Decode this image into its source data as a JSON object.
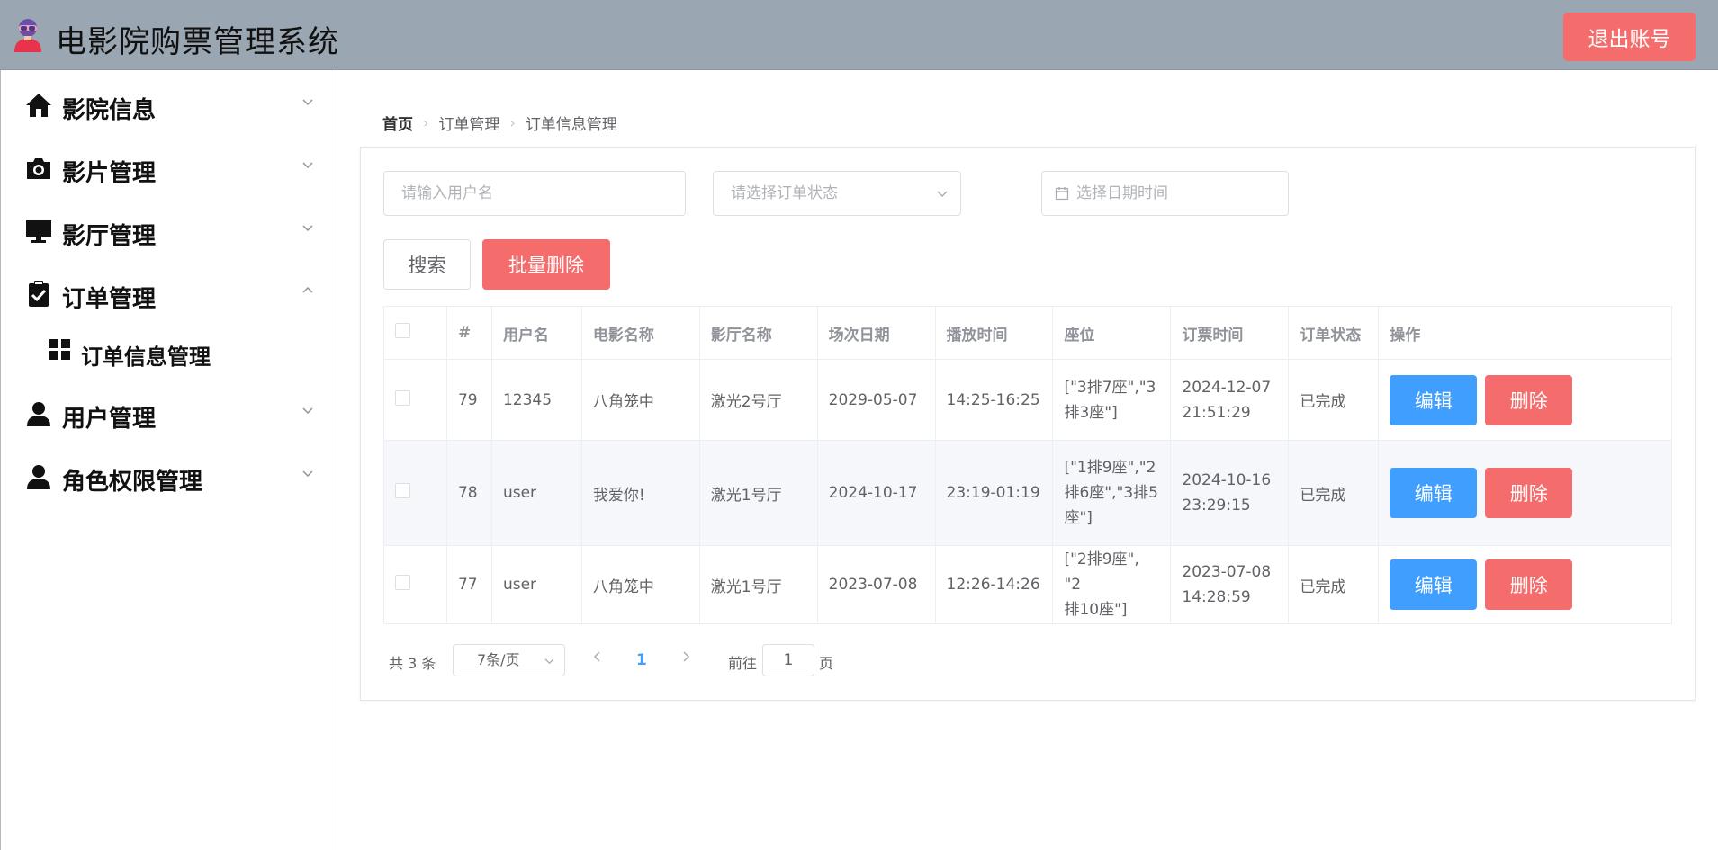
{
  "header": {
    "title": "电影院购票管理系统",
    "logout_label": "退出账号"
  },
  "sidebar": {
    "items": [
      {
        "label": "影院信息",
        "icon": "home-icon",
        "expanded": false
      },
      {
        "label": "影片管理",
        "icon": "camera-icon",
        "expanded": false
      },
      {
        "label": "影厅管理",
        "icon": "monitor-icon",
        "expanded": false
      },
      {
        "label": "订单管理",
        "icon": "clipboard-check-icon",
        "expanded": true,
        "children": [
          {
            "label": "订单信息管理",
            "icon": "grid-icon"
          }
        ]
      },
      {
        "label": "用户管理",
        "icon": "user-icon",
        "expanded": false
      },
      {
        "label": "角色权限管理",
        "icon": "user-icon",
        "expanded": false
      }
    ]
  },
  "breadcrumb": [
    "首页",
    "订单管理",
    "订单信息管理"
  ],
  "filters": {
    "username_placeholder": "请输入用户名",
    "status_placeholder": "请选择订单状态",
    "date_placeholder": "选择日期时间"
  },
  "actions": {
    "search_label": "搜索",
    "batch_delete_label": "批量删除"
  },
  "table": {
    "columns": [
      "#",
      "用户名",
      "电影名称",
      "影厅名称",
      "场次日期",
      "播放时间",
      "座位",
      "订票时间",
      "订单状态",
      "操作"
    ],
    "rows": [
      {
        "id": "79",
        "username": "12345",
        "movie": "八角笼中",
        "hall": "激光2号厅",
        "date": "2029-05-07",
        "time": "14:25-16:25",
        "seats_lines": [
          "[\"3排7座\",\"3",
          "排3座\"]"
        ],
        "order_time_lines": [
          "2024-12-07",
          "21:51:29"
        ],
        "status": "已完成"
      },
      {
        "id": "78",
        "username": "user",
        "movie": "我爱你!",
        "hall": "激光1号厅",
        "date": "2024-10-17",
        "time": "23:19-01:19",
        "seats_lines": [
          "[\"1排9座\",\"2",
          "排6座\",\"3排5",
          "座\"]"
        ],
        "order_time_lines": [
          "2024-10-16",
          "23:29:15"
        ],
        "status": "已完成"
      },
      {
        "id": "77",
        "username": "user",
        "movie": "八角笼中",
        "hall": "激光1号厅",
        "date": "2023-07-08",
        "time": "12:26-14:26",
        "seats_lines": [
          "[\"2排9座\", \"2",
          "排10座\"]"
        ],
        "order_time_lines": [
          "2023-07-08",
          "14:28:59"
        ],
        "status": "已完成"
      }
    ],
    "edit_label": "编辑",
    "delete_label": "删除"
  },
  "pagination": {
    "total_text": "共 3 条",
    "page_size": "7条/页",
    "current_page": "1",
    "goto_prefix": "前往",
    "goto_value": "1",
    "goto_suffix": "页"
  },
  "colors": {
    "header_bg": "#9aa6b2",
    "danger": "#f56c6c",
    "primary": "#409eff",
    "success": "#67c23a"
  }
}
